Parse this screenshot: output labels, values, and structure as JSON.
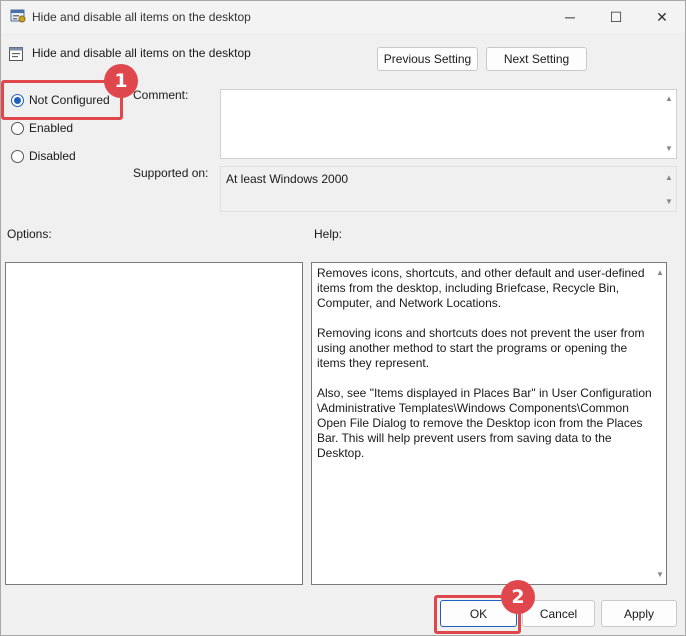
{
  "window": {
    "title": "Hide and disable all items on the desktop",
    "controls": {
      "minimize": "─",
      "maximize": "☐",
      "close": "✕"
    }
  },
  "header": {
    "policy_name": "Hide and disable all items on the desktop",
    "previous_label": "Previous Setting",
    "next_label": "Next Setting"
  },
  "state": {
    "options": [
      {
        "label": "Not Configured",
        "checked": true
      },
      {
        "label": "Enabled",
        "checked": false
      },
      {
        "label": "Disabled",
        "checked": false
      }
    ]
  },
  "comment": {
    "label": "Comment:",
    "value": ""
  },
  "supported": {
    "label": "Supported on:",
    "value": "At least Windows 2000"
  },
  "options_panel": {
    "label": "Options:"
  },
  "help_panel": {
    "label": "Help:",
    "text": "Removes icons, shortcuts, and other default and user-defined items from the desktop, including Briefcase, Recycle Bin, Computer, and Network Locations.\n\nRemoving icons and shortcuts does not prevent the user from using another method to start the programs or opening the items they represent.\n\nAlso, see \"Items displayed in Places Bar\" in User Configuration \\Administrative Templates\\Windows Components\\Common Open File Dialog to remove the Desktop icon from the Places Bar. This will help prevent users from saving data to the Desktop."
  },
  "footer": {
    "ok_label": "OK",
    "cancel_label": "Cancel",
    "apply_label": "Apply"
  },
  "annotations": {
    "step1": "1",
    "step2": "2",
    "color": "#e0474c"
  },
  "icons": {
    "title": "policy-settings-icon",
    "header": "policy-document-icon"
  }
}
